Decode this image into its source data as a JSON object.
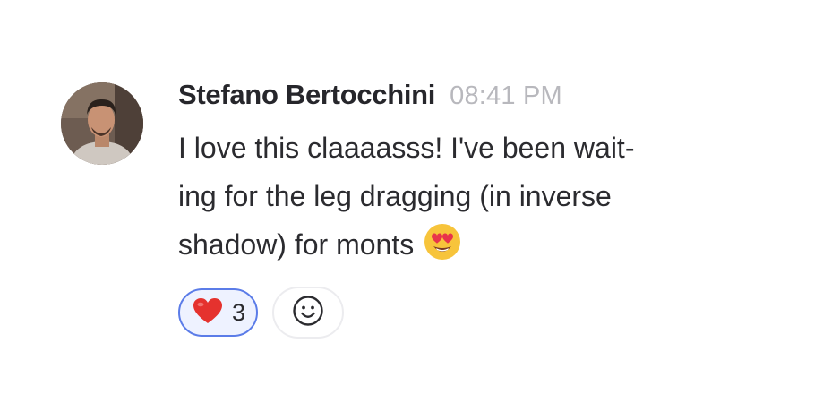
{
  "message": {
    "author": "Stefano Bertocchini",
    "time": "08:41 PM",
    "text": "I love this claaaasss! I've been waiting for the leg dragging (in inverse shadow) for monts",
    "text_lines": [
      "I love this claaaasss! I've been wait-",
      "ing for the leg dragging (in inverse",
      "shadow) for monts"
    ],
    "inline_emoji": "heart-eyes-face-icon"
  },
  "reactions": [
    {
      "icon": "red-heart-icon",
      "count": "3",
      "selected": true
    }
  ],
  "add_reaction": {
    "icon": "smiley-face-icon"
  },
  "colors": {
    "selected_border": "#5b7ce8",
    "selected_background": "#eef2ff",
    "timestamp": "#b8b8bd"
  }
}
